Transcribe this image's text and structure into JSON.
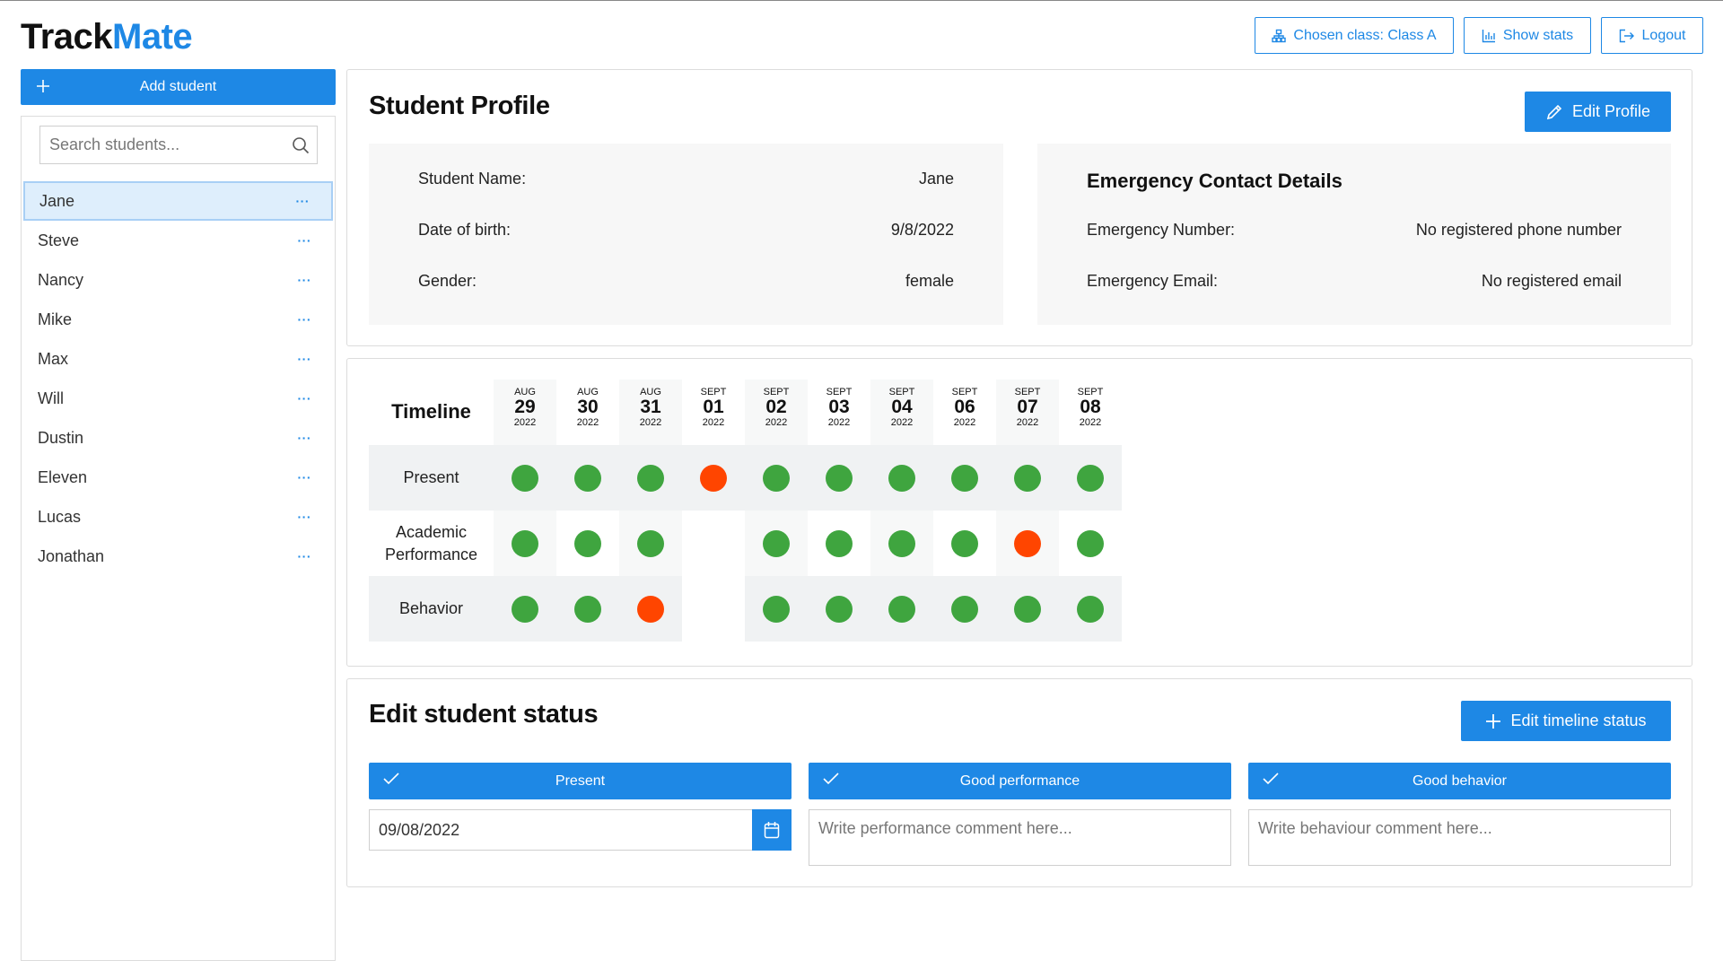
{
  "app": {
    "logo_dark": "Track",
    "logo_accent": "Mate"
  },
  "header": {
    "chosen_class": "Chosen class: Class A",
    "show_stats": "Show stats",
    "logout": "Logout"
  },
  "sidebar": {
    "add_student": "Add student",
    "search_placeholder": "Search students...",
    "more": "···",
    "students": [
      "Jane",
      "Steve",
      "Nancy",
      "Mike",
      "Max",
      "Will",
      "Dustin",
      "Eleven",
      "Lucas",
      "Jonathan"
    ]
  },
  "profile": {
    "title": "Student Profile",
    "edit_button": "Edit Profile",
    "name_label": "Student Name:",
    "name_value": "Jane",
    "dob_label": "Date of birth:",
    "dob_value": "9/8/2022",
    "gender_label": "Gender:",
    "gender_value": "female",
    "emergency_title": "Emergency Contact Details",
    "emergency_number_label": "Emergency Number:",
    "emergency_number_value": "No registered phone number",
    "emergency_email_label": "Emergency Email:",
    "emergency_email_value": "No registered email"
  },
  "timeline": {
    "title": "Timeline",
    "dates": [
      {
        "mon": "AUG",
        "day": "29",
        "year": "2022"
      },
      {
        "mon": "AUG",
        "day": "30",
        "year": "2022"
      },
      {
        "mon": "AUG",
        "day": "31",
        "year": "2022"
      },
      {
        "mon": "SEPT",
        "day": "01",
        "year": "2022"
      },
      {
        "mon": "SEPT",
        "day": "02",
        "year": "2022"
      },
      {
        "mon": "SEPT",
        "day": "03",
        "year": "2022"
      },
      {
        "mon": "SEPT",
        "day": "04",
        "year": "2022"
      },
      {
        "mon": "SEPT",
        "day": "06",
        "year": "2022"
      },
      {
        "mon": "SEPT",
        "day": "07",
        "year": "2022"
      },
      {
        "mon": "SEPT",
        "day": "08",
        "year": "2022"
      }
    ],
    "rows": [
      {
        "label": "Present",
        "values": [
          "good",
          "good",
          "good",
          "bad",
          "good",
          "good",
          "good",
          "good",
          "good",
          "good"
        ]
      },
      {
        "label": "Academic Performance",
        "values": [
          "good",
          "good",
          "good",
          "",
          "good",
          "good",
          "good",
          "good",
          "bad",
          "good"
        ]
      },
      {
        "label": "Behavior",
        "values": [
          "good",
          "good",
          "bad",
          "",
          "good",
          "good",
          "good",
          "good",
          "good",
          "good"
        ]
      }
    ],
    "colors": {
      "good": "#3fa53f",
      "bad": "#ff4500"
    }
  },
  "edit_status": {
    "title": "Edit student status",
    "edit_timeline_button": "Edit timeline status",
    "present": "Present",
    "good_performance": "Good performance",
    "good_behavior": "Good behavior",
    "date_value": "09/08/2022",
    "performance_placeholder": "Write performance comment here...",
    "behaviour_placeholder": "Write behaviour comment here..."
  },
  "colors": {
    "accent": "#1e88e5"
  }
}
